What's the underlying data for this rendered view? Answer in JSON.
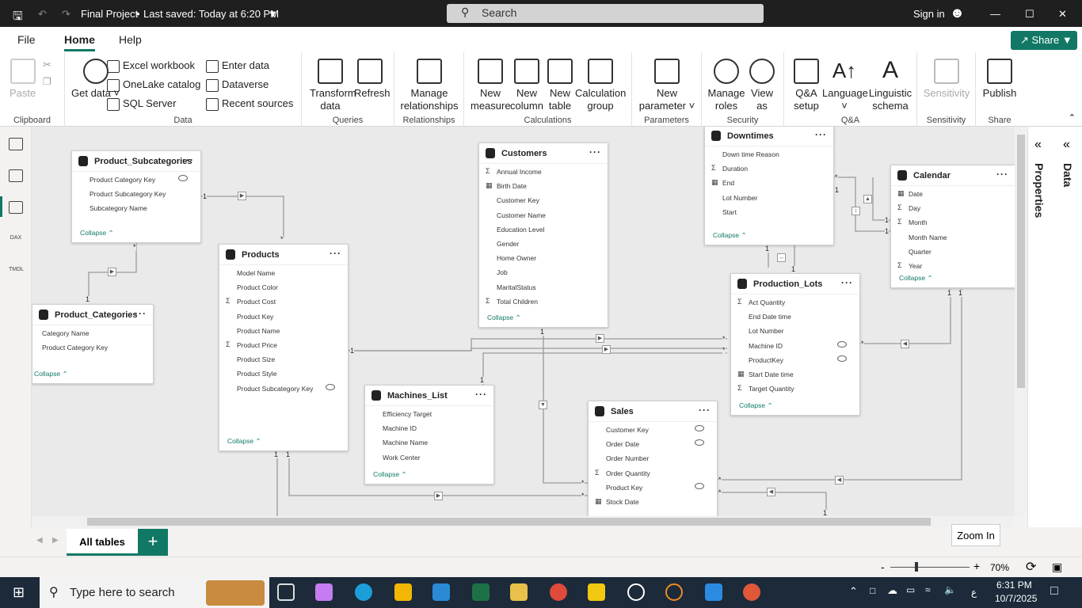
{
  "titlebar": {
    "title": "Final Project",
    "saved": "Last saved: Today at 6:20 PM",
    "search": "Search",
    "signin": "Sign in"
  },
  "tabs": [
    {
      "label": "File"
    },
    {
      "label": "Home"
    },
    {
      "label": "Help"
    }
  ],
  "share": "Share",
  "ribbon": {
    "clipboard": {
      "label": "Clipboard",
      "paste": "Paste"
    },
    "data": {
      "label": "Data",
      "get_data": "Get data",
      "excel": "Excel workbook",
      "onelake": "OneLake catalog",
      "sql": "SQL Server",
      "enter": "Enter data",
      "dataverse": "Dataverse",
      "recent": "Recent sources"
    },
    "queries": {
      "label": "Queries",
      "transform": "Transform data",
      "refresh": "Refresh"
    },
    "relationships": {
      "label": "Relationships",
      "manage": "Manage relationships"
    },
    "calculations": {
      "label": "Calculations",
      "measure": "New measure",
      "column": "New column",
      "table": "New table",
      "group": "Calculation group"
    },
    "parameters": {
      "label": "Parameters",
      "new": "New parameter"
    },
    "security": {
      "label": "Security",
      "roles": "Manage roles",
      "view": "View as"
    },
    "qa": {
      "label": "Q&A",
      "setup": "Q&A setup",
      "language": "Language",
      "schema": "Linguistic schema"
    },
    "sensitivity": {
      "label": "Sensitivity",
      "btn": "Sensitivity"
    },
    "share": {
      "label": "Share",
      "publish": "Publish"
    }
  },
  "rail": {
    "dax": "DAX",
    "tmdl": "TMDL"
  },
  "panels": {
    "properties": "Properties",
    "data": "Data"
  },
  "tables": {
    "subcat": {
      "name": "Product_Subcategories",
      "fields": [
        "Product Category Key",
        "Product Subcategory Key",
        "Subcategory Name"
      ],
      "collapse": "Collapse"
    },
    "cat": {
      "name": "Product_Categories",
      "fields": [
        "Category Name",
        "Product Category Key"
      ],
      "collapse": "Collapse"
    },
    "products": {
      "name": "Products",
      "fields": [
        "Model Name",
        "Product Color",
        "Product Cost",
        "Product Key",
        "Product Name",
        "Product Price",
        "Product Size",
        "Product Style",
        "Product Subcategory Key"
      ],
      "collapse": "Collapse"
    },
    "customers": {
      "name": "Customers",
      "fields": [
        "Annual Income",
        "Birth Date",
        "Customer Key",
        "Customer Name",
        "Education Level",
        "Gender",
        "Home Owner",
        "Job",
        "MaritalStatus",
        "Total Children"
      ],
      "collapse": "Collapse"
    },
    "machines": {
      "name": "Machines_List",
      "fields": [
        "Efficiency Target",
        "Machine ID",
        "Machine Name",
        "Work Center"
      ],
      "collapse": "Collapse"
    },
    "sales": {
      "name": "Sales",
      "fields": [
        "Customer Key",
        "Order Date",
        "Order Number",
        "Order Quantity",
        "Product Key",
        "Stock Date"
      ]
    },
    "downtimes": {
      "name": "Downtimes",
      "fields": [
        "Down time Reason",
        "Duration",
        "End",
        "Lot Number",
        "Start"
      ],
      "collapse": "Collapse"
    },
    "lots": {
      "name": "Production_Lots",
      "fields": [
        "Act Quantity",
        "End Date time",
        "Lot Number",
        "Machine ID",
        "ProductKey",
        "Start Date time",
        "Target Quantity"
      ],
      "collapse": "Collapse"
    },
    "calendar": {
      "name": "Calendar",
      "fields": [
        "Date",
        "Day",
        "Month",
        "Month Name",
        "Quarter",
        "Year"
      ],
      "collapse": "Collapse"
    }
  },
  "bottom": {
    "all_tables": "All tables",
    "add": "+",
    "zoom_tooltip": "Zoom In",
    "zoom": "70%"
  },
  "taskbar": {
    "search": "Type here to search",
    "time": "6:31 PM",
    "date": "10/7/2025",
    "lang": "ع"
  }
}
